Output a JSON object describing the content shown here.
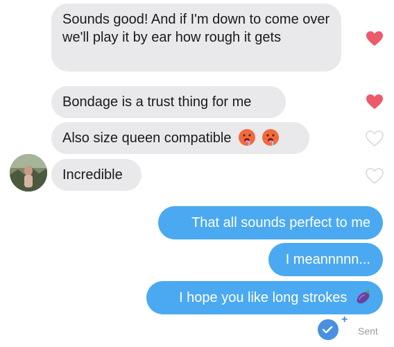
{
  "incoming": [
    {
      "text": "Sounds good! And if I'm down to come over we'll play it by ear how rough it gets",
      "liked": true
    },
    {
      "text": "Bondage is a trust thing for me",
      "liked": true
    },
    {
      "text": "Also size queen compatible",
      "liked": false
    },
    {
      "text": "Incredible",
      "liked": false
    }
  ],
  "outgoing": [
    {
      "text": "That all sounds perfect to me"
    },
    {
      "text": "I meannnnn..."
    },
    {
      "text": "I hope you like long strokes"
    }
  ],
  "status": {
    "label": "Sent",
    "plus": "+"
  },
  "colors": {
    "incoming_bg": "#e9e9eb",
    "outgoing_bg": "#4ba9f1",
    "heart_liked": "#ec5a6b",
    "heart_empty": "#d8d8d8"
  }
}
